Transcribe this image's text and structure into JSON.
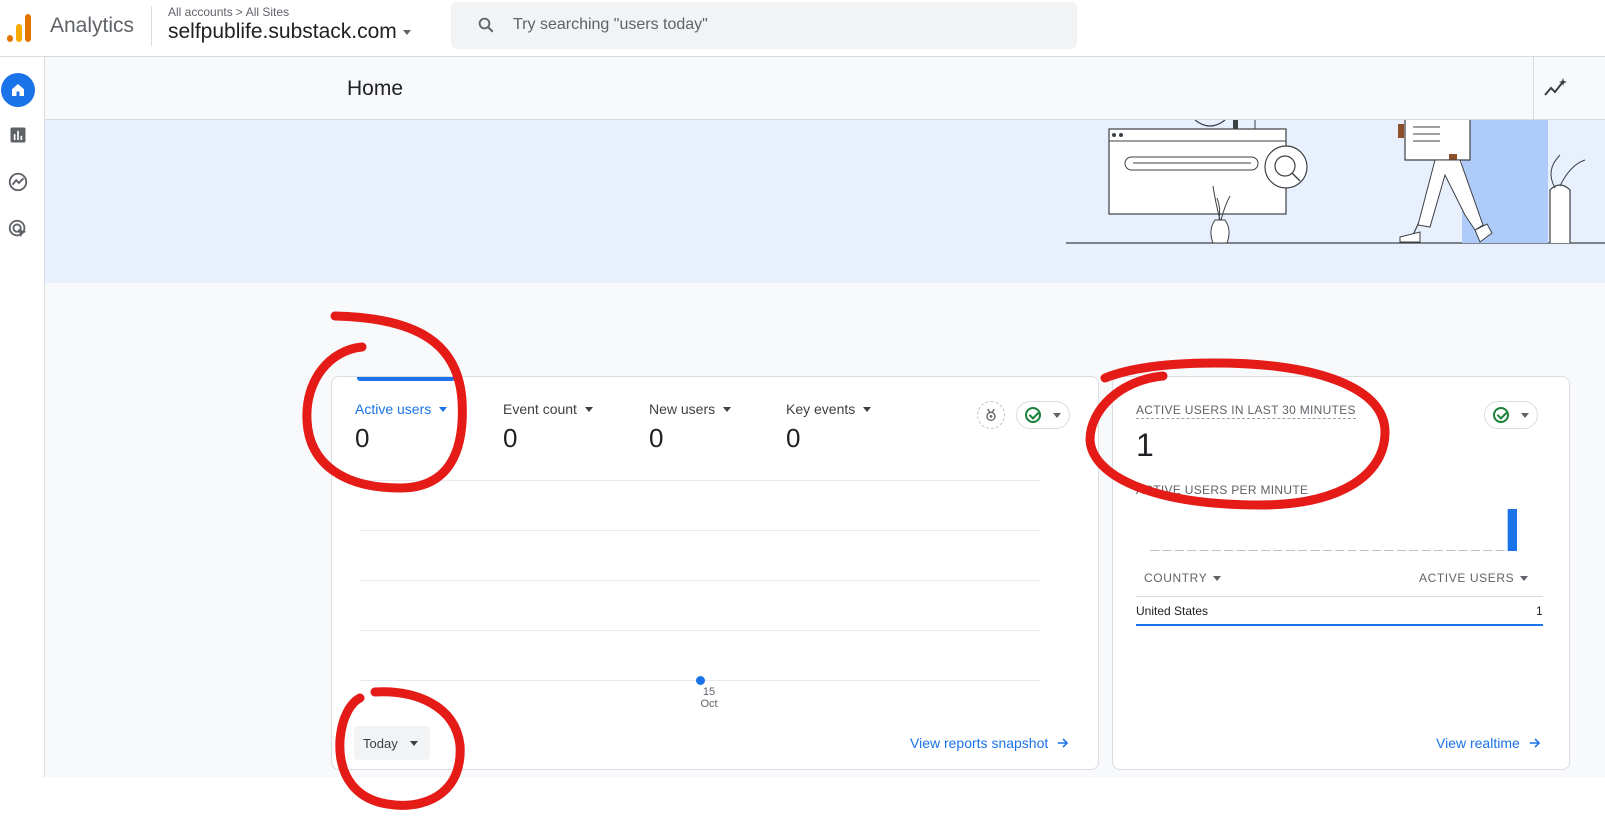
{
  "topbar": {
    "app_name": "Analytics",
    "breadcrumb": {
      "account": "All accounts",
      "separator": ">",
      "scope": "All Sites"
    },
    "property": "selfpublife.substack.com",
    "search_placeholder": "Try searching \"users today\""
  },
  "rail": {
    "items": [
      {
        "name": "Home",
        "icon": "home-icon",
        "active": true
      },
      {
        "name": "Reports",
        "icon": "bar-chart-icon"
      },
      {
        "name": "Explore",
        "icon": "explore-icon"
      },
      {
        "name": "Advertising",
        "icon": "advertising-icon"
      }
    ]
  },
  "header": {
    "title": "Home",
    "insights_icon": "insights-icon"
  },
  "overview_card": {
    "metrics": [
      {
        "label": "Active users",
        "value": "0",
        "active": true
      },
      {
        "label": "Event count",
        "value": "0"
      },
      {
        "label": "New users",
        "value": "0"
      },
      {
        "label": "Key events",
        "value": "0"
      }
    ],
    "date_range": "Today",
    "x_tick": {
      "day": "15",
      "month": "Oct"
    },
    "link": "View reports snapshot"
  },
  "realtime_card": {
    "title": "ACTIVE USERS IN LAST 30 MINUTES",
    "value": "1",
    "per_minute_label": "ACTIVE USERS PER MINUTE",
    "table": {
      "col_country": "COUNTRY",
      "col_users": "ACTIVE USERS",
      "rows": [
        {
          "country": "United States",
          "users": "1"
        }
      ]
    },
    "link": "View realtime"
  },
  "colors": {
    "accent": "#1a73e8",
    "annotation": "#e41b17",
    "logo_orange": "#e37400",
    "logo_yellow": "#f9ab00"
  },
  "chart_data": [
    {
      "type": "line",
      "series": [
        {
          "values": [
            0
          ]
        }
      ],
      "categories": [
        "15 Oct"
      ],
      "grid": true
    },
    {
      "type": "bar",
      "values": [
        0,
        0,
        0,
        0,
        0,
        0,
        0,
        0,
        0,
        0,
        0,
        0,
        0,
        0,
        0,
        0,
        0,
        0,
        0,
        0,
        0,
        0,
        0,
        0,
        0,
        0,
        0,
        0,
        0,
        1
      ],
      "grid": false
    }
  ]
}
